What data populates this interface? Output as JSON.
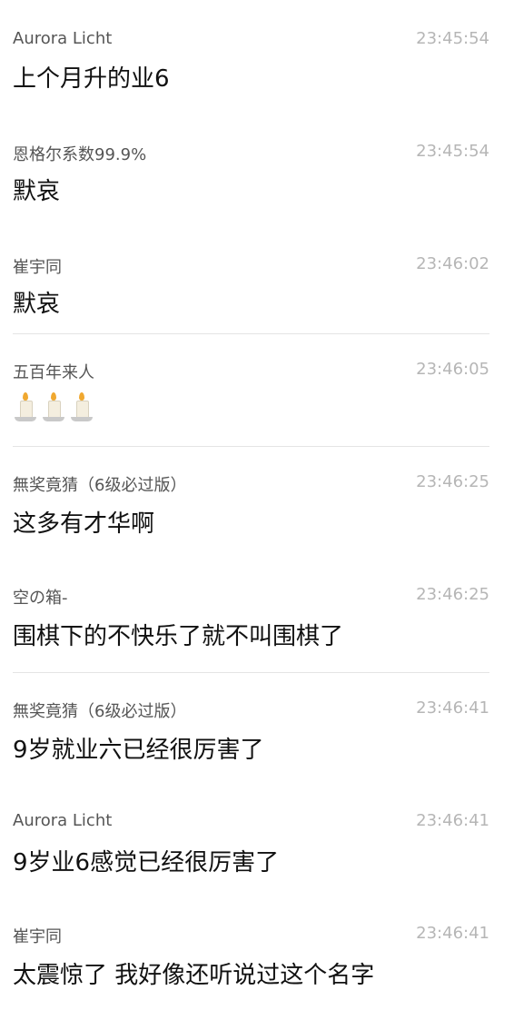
{
  "messages": [
    {
      "name": "Aurora Licht",
      "time": "23:45:54",
      "text": "上个月升的业6",
      "divider": false
    },
    {
      "name": "恩格尔系数99.9%",
      "time": "23:45:54",
      "text": "默哀",
      "divider": false
    },
    {
      "name": "崔宇同",
      "time": "23:46:02",
      "text": "默哀",
      "divider": false
    },
    {
      "name": "五百年来人",
      "time": "23:46:05",
      "emoji": "candle-icon ×3",
      "divider": true
    },
    {
      "name": "無奖竟猜（6级必过版）",
      "time": "23:46:25",
      "text": "这多有才华啊",
      "divider": true
    },
    {
      "name": "空の箱-",
      "time": "23:46:25",
      "text": "围棋下的不快乐了就不叫围棋了",
      "divider": false
    },
    {
      "name": "無奖竟猜（6级必过版）",
      "time": "23:46:41",
      "text": "9岁就业六已经很厉害了",
      "divider": true
    },
    {
      "name": "Aurora Licht",
      "time": "23:46:41",
      "text": "9岁业6感觉已经很厉害了",
      "divider": false
    },
    {
      "name": "崔宇同",
      "time": "23:46:41",
      "text": "太震惊了 我好像还听说过这个名字",
      "divider": false
    }
  ],
  "colors": {
    "name": "#555555",
    "time": "#b6b6b6",
    "message": "#111111",
    "divider": "#e4e4e4",
    "background": "#ffffff"
  }
}
